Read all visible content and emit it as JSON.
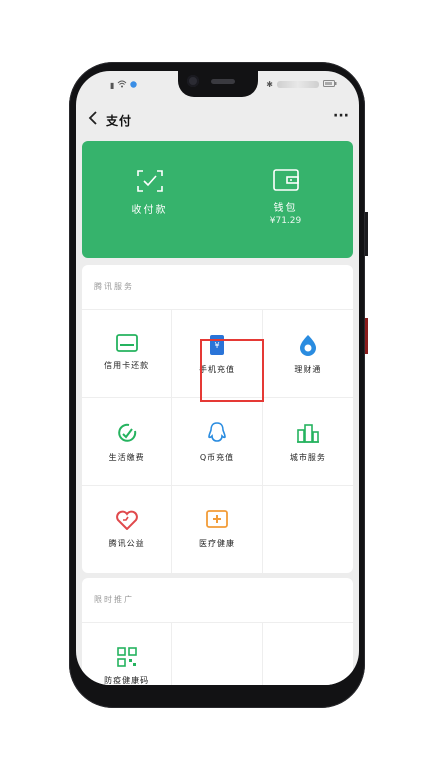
{
  "header": {
    "back_icon": "chevron-left-icon",
    "title": "支付",
    "more_label": "···"
  },
  "status_bar": {
    "left_icons": [
      "sim-icon",
      "wifi-icon",
      "location-icon"
    ],
    "right_icons": [
      "bluetooth-icon",
      "signal-icon",
      "battery-icon"
    ]
  },
  "wallet_banner": {
    "background": "#36b36c",
    "items": [
      {
        "icon": "scan-check-icon",
        "label": "收付款"
      },
      {
        "icon": "wallet-icon",
        "label": "钱包",
        "balance": "¥71.29"
      }
    ]
  },
  "tencent_services": {
    "section_title": "腾讯服务",
    "items": [
      {
        "icon": "credit-card-icon",
        "label": "信用卡还款",
        "color": "#25b35f"
      },
      {
        "icon": "phone-topup-icon",
        "label": "手机充值",
        "color": "#2a74d8"
      },
      {
        "icon": "wealth-icon",
        "label": "理财通",
        "color": "#2a8ce0"
      },
      {
        "icon": "utilities-icon",
        "label": "生活缴费",
        "color": "#25b35f"
      },
      {
        "icon": "qq-coin-icon",
        "label": "Q币充值",
        "color": "#2a8ce0"
      },
      {
        "icon": "city-service-icon",
        "label": "城市服务",
        "color": "#25b35f",
        "highlighted": true
      },
      {
        "icon": "charity-heart-icon",
        "label": "腾讯公益",
        "color": "#e0494c"
      },
      {
        "icon": "medical-cross-icon",
        "label": "医疗健康",
        "color": "#f29c38"
      }
    ]
  },
  "limited_promo": {
    "section_title": "限时推广",
    "items": [
      {
        "icon": "qr-code-icon",
        "label": "防疫健康码",
        "color": "#25b35f"
      }
    ]
  },
  "highlight_color": "#e53935"
}
